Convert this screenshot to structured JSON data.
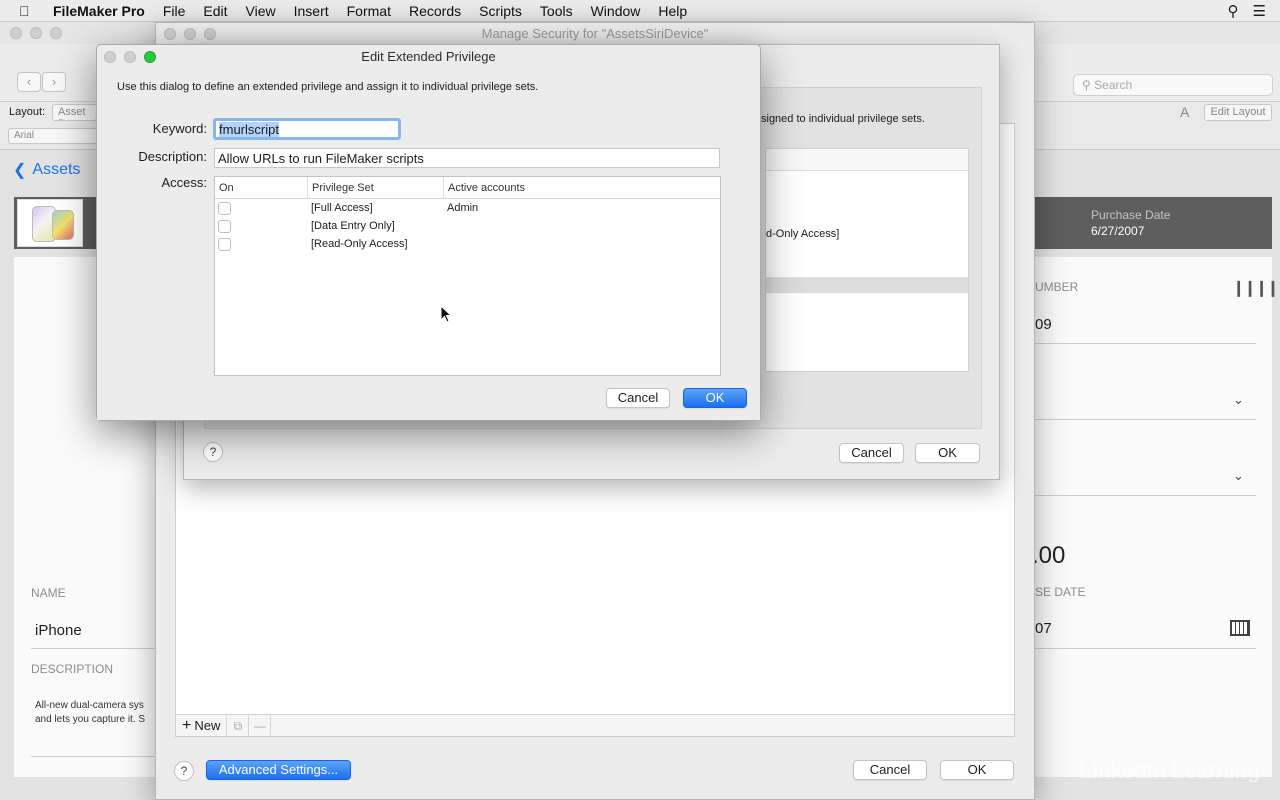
{
  "menubar": {
    "app_name": "FileMaker Pro",
    "items": [
      "File",
      "Edit",
      "View",
      "Insert",
      "Format",
      "Records",
      "Scripts",
      "Tools",
      "Window",
      "Help"
    ]
  },
  "fm": {
    "search_placeholder": "Search",
    "layout_label": "Layout:",
    "layout_value": "Asset D",
    "font_value": "Arial",
    "edit_layout": "Edit Layout",
    "font_size_icon": "A",
    "back_label": "Assets",
    "purchase_date_label": "Purchase Date",
    "purchase_date_value": "6/27/2007",
    "number_label": "UMBER",
    "number_value": "09",
    "price_value": ".00",
    "se_date_label": "SE DATE",
    "se_date_value": "07",
    "name_label": "NAME",
    "name_value": "iPhone",
    "description_label": "DESCRIPTION",
    "description_line1": "All-new dual-camera sys",
    "description_line2": "and lets you capture it. S"
  },
  "manage_security": {
    "title": "Manage Security for \"AssetsSiriDevice\"",
    "new_label": "New",
    "advanced_settings": "Advanced Settings...",
    "cancel": "Cancel",
    "ok": "OK",
    "help": "?"
  },
  "edit_privilege_set": {
    "info_text": "signed to individual privilege sets.",
    "row_text": "d-Only Access]",
    "cancel": "Cancel",
    "ok": "OK",
    "help": "?"
  },
  "edit_extended_privilege": {
    "title": "Edit Extended Privilege",
    "instructions": "Use this dialog to define an extended privilege and assign it to individual privilege sets.",
    "keyword_label": "Keyword:",
    "keyword_value": "fmurlscript",
    "description_label": "Description:",
    "description_value": "Allow URLs to run FileMaker scripts",
    "access_label": "Access:",
    "columns": {
      "on": "On",
      "privilege_set": "Privilege Set",
      "active_accounts": "Active accounts"
    },
    "rows": [
      {
        "set": "[Full Access]",
        "accounts": "Admin"
      },
      {
        "set": "[Data Entry Only]",
        "accounts": ""
      },
      {
        "set": "[Read-Only Access]",
        "accounts": ""
      }
    ],
    "cancel": "Cancel",
    "ok": "OK"
  },
  "watermark": "LinkedIn Learning",
  "colors": {
    "accent": "#1b6ff1",
    "selection": "#b3d3fb",
    "focus_ring": "#87b5f2"
  }
}
